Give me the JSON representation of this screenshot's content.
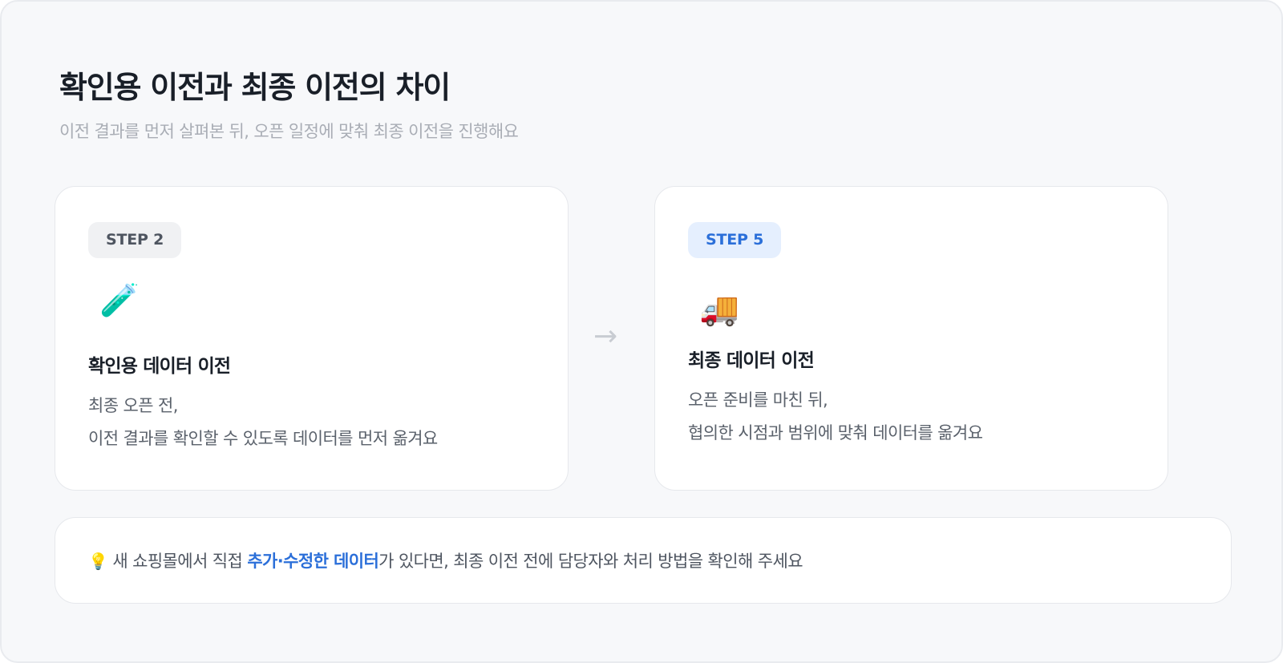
{
  "header": {
    "title": "확인용 이전과 최종 이전의 차이",
    "subtitle": "이전 결과를 먼저 살펴본 뒤, 오픈 일정에 맞춰 최종 이전을 진행해요"
  },
  "cards": [
    {
      "badge": "STEP 2",
      "icon": "test-tube-icon",
      "emoji": "🧪",
      "title": "확인용 데이터 이전",
      "desc_line1": "최종 오픈 전,",
      "desc_line2": "이전 결과를 확인할 수 있도록 데이터를 먼저 옮겨요"
    },
    {
      "badge": "STEP 5",
      "icon": "delivery-truck-icon",
      "emoji": "🚚",
      "title": "최종 데이터 이전",
      "desc_line1": "오픈 준비를 마친 뒤,",
      "desc_line2": "협의한 시점과 범위에 맞춰 데이터를 옮겨요"
    }
  ],
  "arrow": "→",
  "note": {
    "icon": "lightbulb-icon",
    "emoji": "💡",
    "prefix": "새 쇼핑몰에서 직접 ",
    "highlight": "추가·수정한 데이터",
    "suffix": "가 있다면, 최종 이전 전에 담당자와 처리 방법을 확인해 주세요"
  },
  "colors": {
    "accent": "#2b6fd9",
    "background": "#f7f8fa",
    "badge_gray_bg": "#f0f1f3",
    "badge_blue_bg": "#e5effe"
  }
}
